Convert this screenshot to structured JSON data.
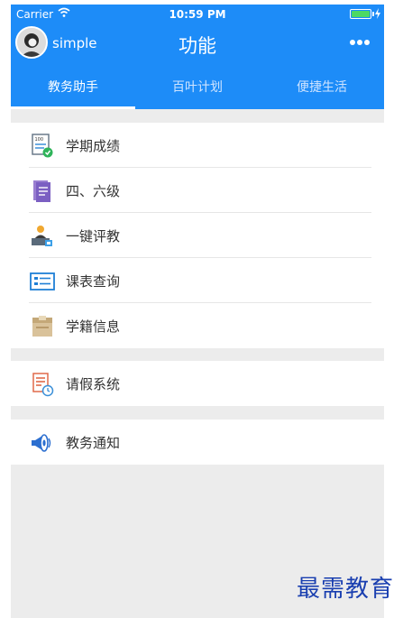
{
  "status_bar": {
    "carrier": "Carrier",
    "time": "10:59 PM",
    "battery_color": "#4cd964"
  },
  "header": {
    "username": "simple",
    "title": "功能",
    "background_color": "#1d8cf8",
    "more_icon": "more-dots-icon"
  },
  "tabs": [
    {
      "label": "教务助手",
      "active": true
    },
    {
      "label": "百叶计划",
      "active": false
    },
    {
      "label": "便捷生活",
      "active": false
    }
  ],
  "groups": [
    {
      "items": [
        {
          "label": "学期成绩",
          "icon": "grade-report-icon"
        },
        {
          "label": "四、六级",
          "icon": "document-purple-icon"
        },
        {
          "label": "一键评教",
          "icon": "teacher-evaluation-icon"
        },
        {
          "label": "课表查询",
          "icon": "schedule-card-icon"
        },
        {
          "label": "学籍信息",
          "icon": "student-record-icon"
        }
      ]
    },
    {
      "items": [
        {
          "label": "请假系统",
          "icon": "leave-clock-icon"
        }
      ]
    },
    {
      "items": [
        {
          "label": "教务通知",
          "icon": "megaphone-icon"
        }
      ]
    }
  ],
  "watermark": "最需教育"
}
